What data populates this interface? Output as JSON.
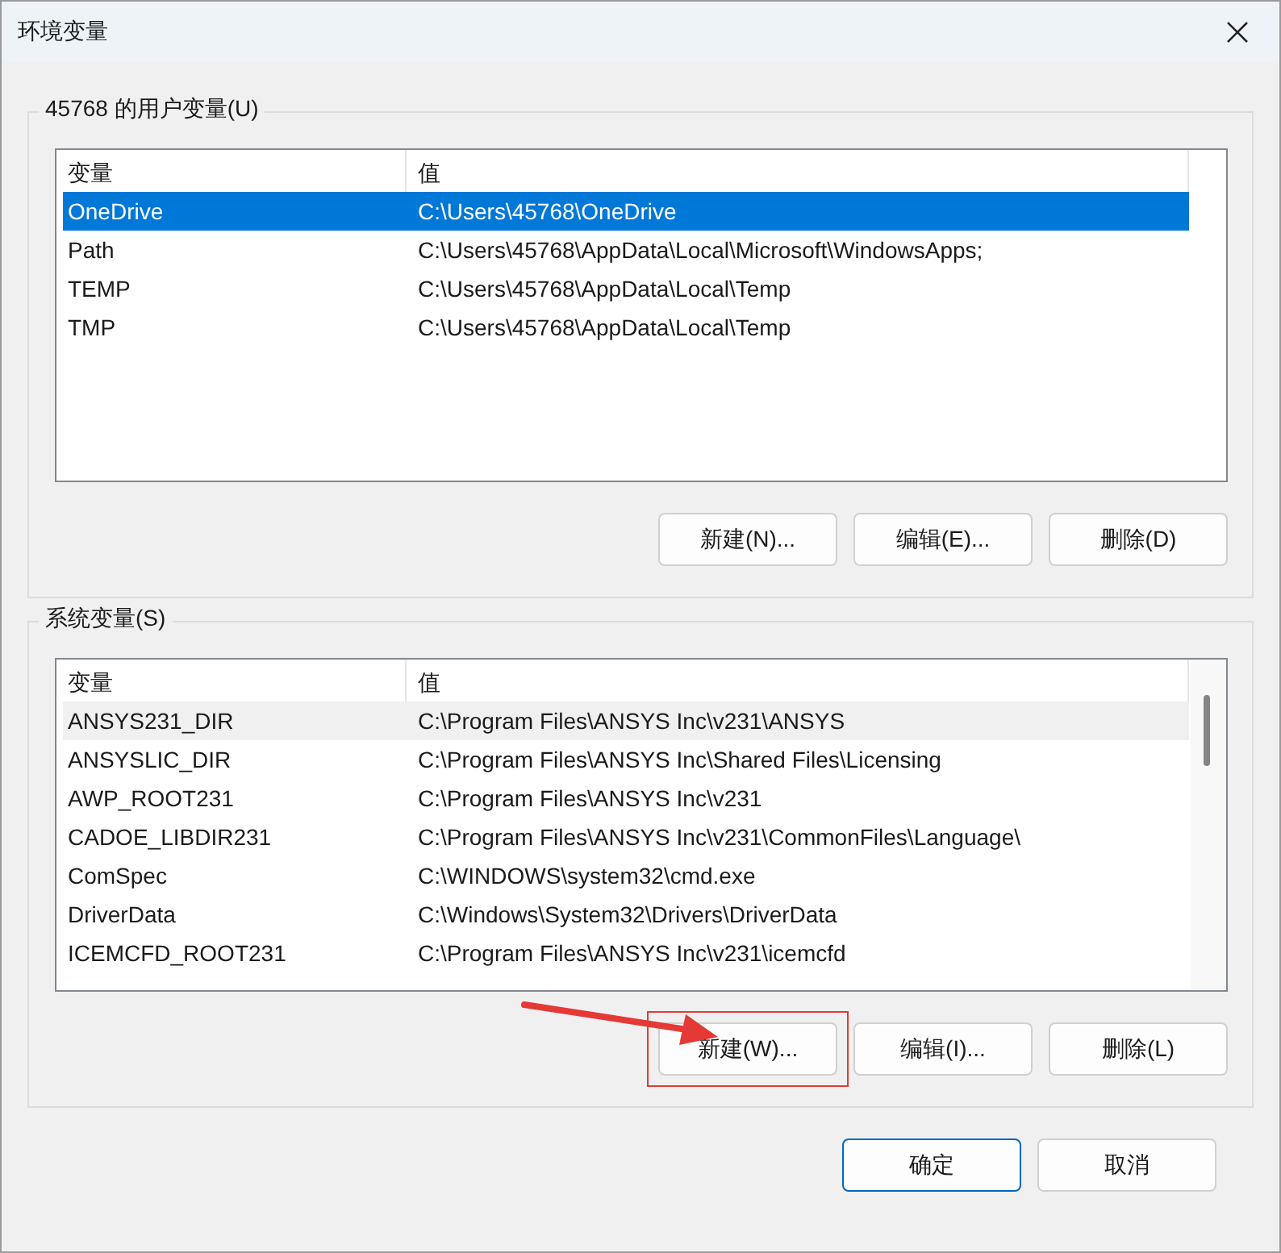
{
  "window": {
    "title": "环境变量"
  },
  "groups": [
    {
      "label": "45768 的用户变量(U)",
      "focused": true,
      "scrollbar": false,
      "columns": [
        "变量",
        "值"
      ],
      "rows": [
        {
          "name": "OneDrive",
          "value": "C:\\Users\\45768\\OneDrive",
          "selected": true
        },
        {
          "name": "Path",
          "value": "C:\\Users\\45768\\AppData\\Local\\Microsoft\\WindowsApps;",
          "selected": false
        },
        {
          "name": "TEMP",
          "value": "C:\\Users\\45768\\AppData\\Local\\Temp",
          "selected": false
        },
        {
          "name": "TMP",
          "value": "C:\\Users\\45768\\AppData\\Local\\Temp",
          "selected": false
        }
      ],
      "buttons": [
        {
          "label": "新建(N)...",
          "annotated": false
        },
        {
          "label": "编辑(E)...",
          "annotated": false
        },
        {
          "label": "删除(D)",
          "annotated": false
        }
      ]
    },
    {
      "label": "系统变量(S)",
      "focused": false,
      "scrollbar": true,
      "columns": [
        "变量",
        "值"
      ],
      "rows": [
        {
          "name": "ANSYS231_DIR",
          "value": "C:\\Program Files\\ANSYS Inc\\v231\\ANSYS",
          "selected": true
        },
        {
          "name": "ANSYSLIC_DIR",
          "value": "C:\\Program Files\\ANSYS Inc\\Shared Files\\Licensing",
          "selected": false
        },
        {
          "name": "AWP_ROOT231",
          "value": "C:\\Program Files\\ANSYS Inc\\v231",
          "selected": false
        },
        {
          "name": "CADOE_LIBDIR231",
          "value": "C:\\Program Files\\ANSYS Inc\\v231\\CommonFiles\\Language\\",
          "selected": false
        },
        {
          "name": "ComSpec",
          "value": "C:\\WINDOWS\\system32\\cmd.exe",
          "selected": false
        },
        {
          "name": "DriverData",
          "value": "C:\\Windows\\System32\\Drivers\\DriverData",
          "selected": false
        },
        {
          "name": "ICEMCFD_ROOT231",
          "value": "C:\\Program Files\\ANSYS Inc\\v231\\icemcfd",
          "selected": false
        }
      ],
      "buttons": [
        {
          "label": "新建(W)...",
          "annotated": true
        },
        {
          "label": "编辑(I)...",
          "annotated": false
        },
        {
          "label": "删除(L)",
          "annotated": false
        }
      ]
    }
  ],
  "footer_buttons": [
    {
      "label": "确定",
      "default": true
    },
    {
      "label": "取消",
      "default": false
    }
  ]
}
